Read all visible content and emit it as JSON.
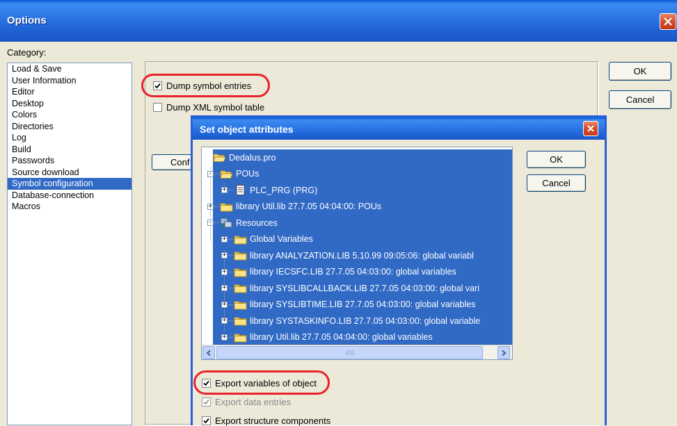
{
  "window": {
    "title": "Options"
  },
  "category_label": "Category:",
  "categories": [
    {
      "label": "Load & Save",
      "selected": false
    },
    {
      "label": "User Information",
      "selected": false
    },
    {
      "label": "Editor",
      "selected": false
    },
    {
      "label": "Desktop",
      "selected": false
    },
    {
      "label": "Colors",
      "selected": false
    },
    {
      "label": "Directories",
      "selected": false
    },
    {
      "label": "Log",
      "selected": false
    },
    {
      "label": "Build",
      "selected": false
    },
    {
      "label": "Passwords",
      "selected": false
    },
    {
      "label": "Source download",
      "selected": false
    },
    {
      "label": "Symbol configuration",
      "selected": true
    },
    {
      "label": "Database-connection",
      "selected": false
    },
    {
      "label": "Macros",
      "selected": false
    }
  ],
  "symbol_panel": {
    "dump_symbol_entries": {
      "label": "Dump symbol entries",
      "checked": true
    },
    "dump_xml_table": {
      "label": "Dump XML symbol table",
      "checked": false
    },
    "configure_button": {
      "label": "Conf"
    }
  },
  "buttons": {
    "ok": "OK",
    "cancel": "Cancel"
  },
  "dialog": {
    "title": "Set object attributes",
    "ok": "OK",
    "cancel": "Cancel",
    "tree": [
      {
        "label": "Dedalus.pro",
        "expander": "",
        "icon": "open-folder-icon"
      },
      {
        "label": "POUs",
        "expander": "-",
        "icon": "open-folder-icon"
      },
      {
        "label": "PLC_PRG (PRG)",
        "expander": "+",
        "icon": "document-icon"
      },
      {
        "label": "library Util.lib 27.7.05 04:04:00: POUs",
        "expander": "+",
        "icon": "folder-icon"
      },
      {
        "label": "Resources",
        "expander": "-",
        "icon": "resources-icon"
      },
      {
        "label": "Global Variables",
        "expander": "+",
        "icon": "folder-icon"
      },
      {
        "label": "library ANALYZATION.LIB 5.10.99 09:05:06: global variabl",
        "expander": "+",
        "icon": "folder-icon"
      },
      {
        "label": "library IECSFC.LIB 27.7.05 04:03:00: global variables",
        "expander": "+",
        "icon": "folder-icon"
      },
      {
        "label": "library SYSLIBCALLBACK.LIB 27.7.05 04:03:00: global vari",
        "expander": "+",
        "icon": "folder-icon"
      },
      {
        "label": "library SYSLIBTIME.LIB 27.7.05 04:03:00: global variables",
        "expander": "+",
        "icon": "folder-icon"
      },
      {
        "label": "library SYSTASKINFO.LIB 27.7.05 04:03:00: global variable",
        "expander": "+",
        "icon": "folder-icon"
      },
      {
        "label": "library Util.lib 27.7.05 04:04:00: global variables",
        "expander": "+",
        "icon": "folder-icon"
      }
    ],
    "export_variables": {
      "label": "Export variables of object",
      "checked": true
    },
    "export_data_entries": {
      "label": "Export data entries",
      "checked": true,
      "disabled": true
    },
    "export_structure": {
      "label": "Export structure components",
      "checked": true
    }
  },
  "colors": {
    "titlebar": "#1f63d6",
    "selection": "#316ac5",
    "highlight_ring": "#e8222a",
    "close_button": "#d6522d"
  }
}
